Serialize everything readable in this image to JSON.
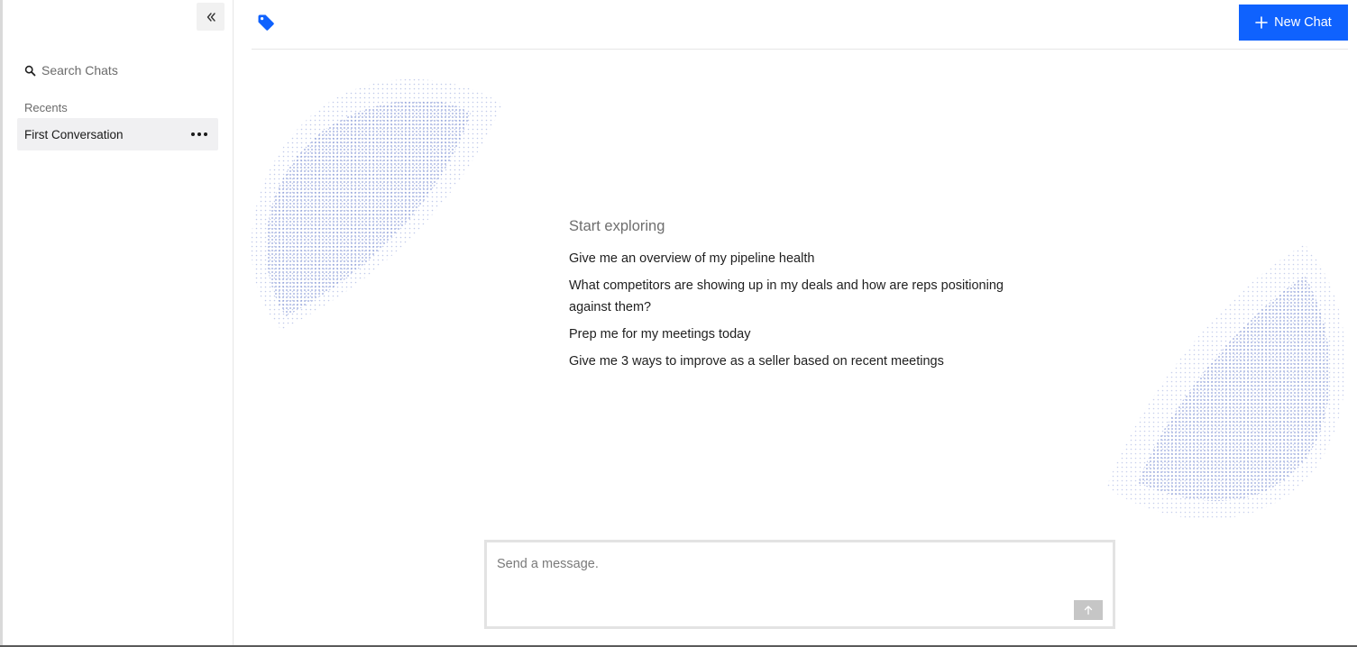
{
  "sidebar": {
    "collapse_icon": "chevrons-left-icon",
    "search_icon": "search-icon",
    "search_placeholder": "Search Chats",
    "recents_label": "Recents",
    "chats": [
      {
        "label": "First Conversation",
        "menu_icon": "more-horizontal-icon",
        "selected": true
      }
    ]
  },
  "header": {
    "logo_icon": "tag-icon",
    "new_chat_label": "New Chat",
    "new_chat_icon": "plus-icon"
  },
  "main": {
    "title": "Start exploring",
    "prompts": [
      "Give me an overview of my pipeline health",
      "What competitors are showing up in my deals and how are reps positioning against them?",
      "Prep me for my meetings today",
      "Give me 3 ways to improve as a seller based on recent meetings"
    ]
  },
  "composer": {
    "placeholder": "Send a message.",
    "send_icon": "arrow-up-icon"
  },
  "colors": {
    "accent": "#0f62fe",
    "send_button_disabled": "#c6c6c6",
    "selected_item_bg": "#f0f0f2",
    "dot_pattern": "#5b73c8"
  }
}
